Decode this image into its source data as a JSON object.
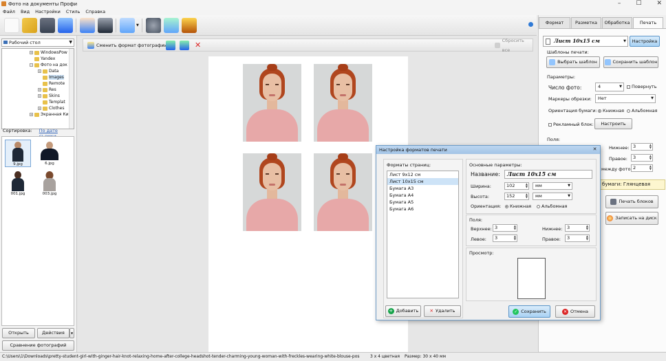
{
  "window": {
    "title": "Фото на документы Профи",
    "min": "–",
    "max": "☐",
    "close": "✕"
  },
  "menu": [
    "Файл",
    "Вид",
    "Настройки",
    "Стиль",
    "Справка"
  ],
  "left": {
    "folder": "Рабочий стол",
    "tree": [
      {
        "label": "WindowsPow",
        "indent": 4,
        "expander": "+"
      },
      {
        "label": "Yandex",
        "indent": 4,
        "expander": ""
      },
      {
        "label": "Фото на док",
        "indent": 4,
        "expander": "−"
      },
      {
        "label": "Data",
        "indent": 5,
        "expander": "+"
      },
      {
        "label": "Images",
        "indent": 5,
        "expander": "",
        "selected": true
      },
      {
        "label": "Remote",
        "indent": 5,
        "expander": ""
      },
      {
        "label": "Res",
        "indent": 5,
        "expander": "+"
      },
      {
        "label": "Skins",
        "indent": 5,
        "expander": "+"
      },
      {
        "label": "Templat",
        "indent": 5,
        "expander": ""
      },
      {
        "label": "Clothes",
        "indent": 5,
        "expander": "+"
      },
      {
        "label": "Экранная Ки",
        "indent": 4,
        "expander": "+"
      }
    ],
    "sort_label": "Сортировка:",
    "sort_value": "По дате съемки",
    "thumbs": [
      {
        "name": "9.jpg",
        "selected": true
      },
      {
        "name": "6.jpg"
      },
      {
        "name": "001.jpg"
      },
      {
        "name": "003.jpg"
      }
    ],
    "open_button": "Открыть",
    "actions_button": "Действия",
    "compare_button": "Сравнение фотографий"
  },
  "center": {
    "change_format_button": "Сменить формат фотографии",
    "reset_all_button": "Сбросить все"
  },
  "right": {
    "tabs": [
      {
        "label": "Формат"
      },
      {
        "label": "Разметка"
      },
      {
        "label": "Обработка"
      },
      {
        "label": "Печать",
        "active": true
      }
    ],
    "paper": "Лист 10х15 см",
    "settings_button": "Настройка",
    "templates_label": "Шаблоны печати:",
    "choose_template": "Выбрать шаблон",
    "save_template": "Сохранить шаблон",
    "params_label": "Параметры:",
    "photo_count_label": "Число фото:",
    "photo_count": "4",
    "rotate_label": "Повернуть",
    "crop_markers_label": "Маркеры обрезки:",
    "crop_markers": "Нет",
    "orientation_label": "Ориентация бумаги:",
    "portrait": "Книжная",
    "landscape": "Альбомная",
    "ad_label": "Рекламный блок:",
    "ad_button": "Настроить",
    "fields_label": "Поля:",
    "bottom_label": "Нижнее:",
    "bottom": "3",
    "right_label": "Правое:",
    "right": "3",
    "between_label": "между фото:",
    "between": "2",
    "paper_type": "бумаги: Глянцевая",
    "print_blocks": "Печать блоков",
    "write_disk": "Записать на диск"
  },
  "dialog": {
    "title": "Настройка форматов печати",
    "close": "✕",
    "formats_label": "Форматы страниц:",
    "formats": [
      {
        "label": "Лист 9х12 см"
      },
      {
        "label": "Лист 10х15 см",
        "selected": true
      },
      {
        "label": "Бумага А3"
      },
      {
        "label": "Бумага А4"
      },
      {
        "label": "Бумага А5"
      },
      {
        "label": "Бумага А6"
      }
    ],
    "main_params_label": "Основные параметры:",
    "name_label": "Название:",
    "name_value": "Лист 10х15 см",
    "width_label": "Ширина:",
    "width": "102",
    "height_label": "Высота:",
    "height": "152",
    "unit": "мм",
    "orientation_label": "Ориентация:",
    "portrait": "Книжная",
    "landscape": "Альбомная",
    "fields_label": "Поля:",
    "top_label": "Верхнее:",
    "top": "3",
    "bottom_label": "Нижнее:",
    "bottom": "3",
    "left_label": "Левое:",
    "left": "3",
    "right_label": "Правое:",
    "right": "3",
    "preview_label": "Просмотр:",
    "add_button": "Добавить",
    "delete_button": "Удалить",
    "save_button": "Сохранить",
    "cancel_button": "Отмена"
  },
  "status": {
    "path": "C:\\Users\\1\\Downloads\\pretty-student-girl-with-ginger-hair-knot-relaxing-home-after-college-headshot-tender-charming-young-woman-with-freckles-wearing-white-blouse-posing.jpg",
    "color": "3 x 4 цветная",
    "size": "Размер: 30 x 40 мм"
  }
}
